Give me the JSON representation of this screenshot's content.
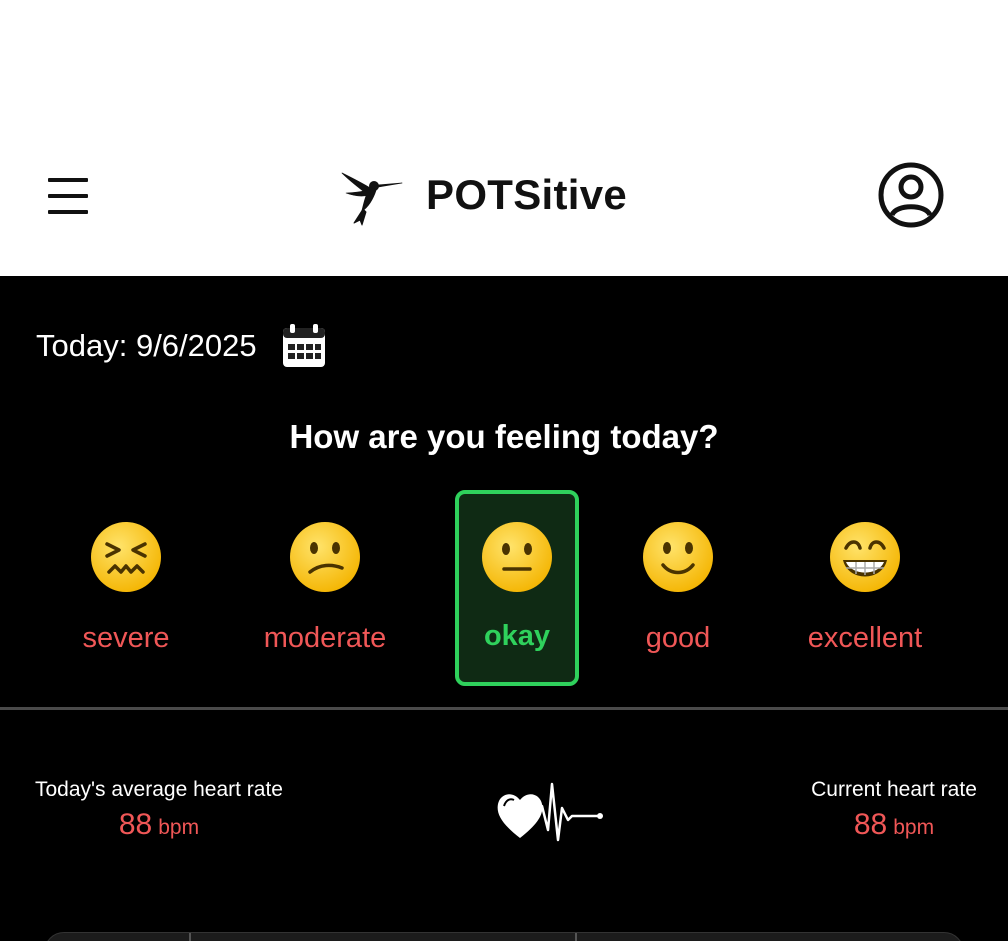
{
  "app": {
    "title": "POTSitive",
    "logo_icon": "hummingbird-icon",
    "menu_icon": "hamburger-menu-icon",
    "profile_icon": "user-profile-icon"
  },
  "date": {
    "text": "Today: 9/6/2025",
    "calendar_icon": "calendar-icon"
  },
  "mood": {
    "question": "How are you feeling today?",
    "options": [
      {
        "label": "severe",
        "icon": "confounded-face-icon"
      },
      {
        "label": "moderate",
        "icon": "confused-face-icon"
      },
      {
        "label": "okay",
        "icon": "neutral-face-icon"
      },
      {
        "label": "good",
        "icon": "slightly-smiling-face-icon"
      },
      {
        "label": "excellent",
        "icon": "grinning-face-icon"
      }
    ],
    "selected": "okay"
  },
  "heart_rate": {
    "average_title": "Today's average heart rate",
    "average_value": "88",
    "average_unit": "bpm",
    "current_title": "Current heart rate",
    "current_value": "88",
    "current_unit": "bpm",
    "icon": "heart-pulse-icon"
  },
  "colors": {
    "accent_red": "#f05757",
    "selected_green": "#2fd15c",
    "background": "#000000"
  }
}
